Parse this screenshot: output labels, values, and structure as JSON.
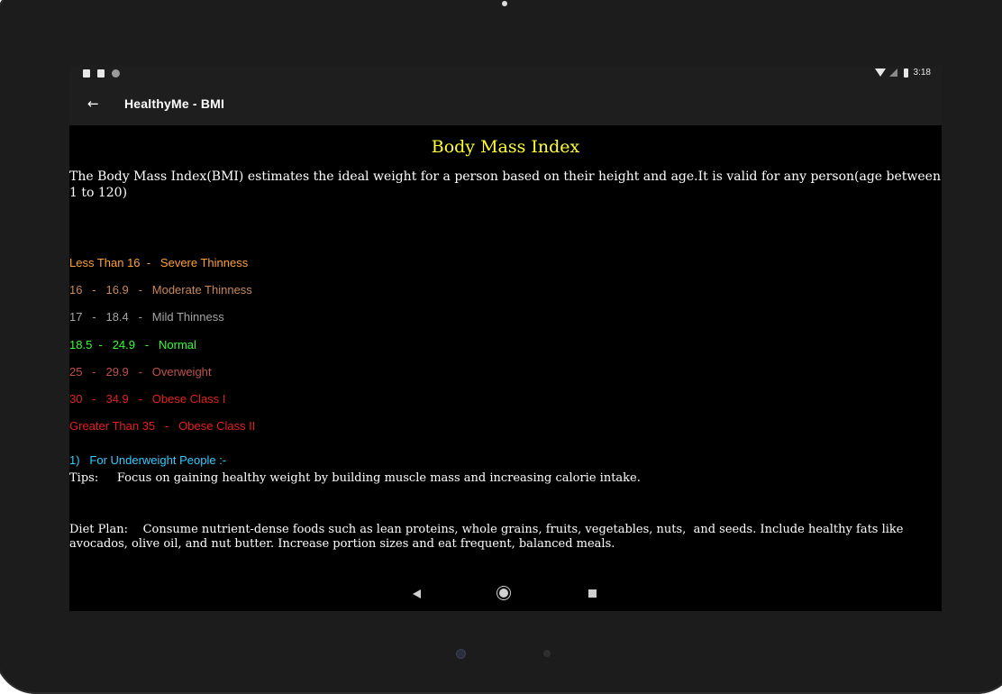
{
  "status_bar": {
    "time": "3:18"
  },
  "toolbar": {
    "back_icon": "←",
    "title": "HealthyMe - BMI"
  },
  "content": {
    "heading": "Body Mass Index",
    "intro": "The Body Mass Index(BMI) estimates the ideal weight for a person based on their height and age.It is valid for any person(age between 1 to 120)",
    "ranges": [
      {
        "text": "Less Than 16  -   Severe Thinness",
        "color": "#ffa033"
      },
      {
        "text": "16   -   16.9   -   Moderate Thinness",
        "color": "#c8885a"
      },
      {
        "text": "17   -   18.4   -   Mild Thinness",
        "color": "#a4a4a4"
      },
      {
        "text": "18.5  -   24.9   -   Normal",
        "color": "#33ff33"
      },
      {
        "text": "25   -   29.9   -   Overweight",
        "color": "#c0504d"
      },
      {
        "text": "30   -   34.9   -   Obese Class I",
        "color": "#e02020"
      },
      {
        "text": "Greater Than 35   -   Obese Class II",
        "color": "#e81e1e"
      }
    ],
    "underweight_heading": "1)   For Underweight People :-",
    "tips": "Tips:     Focus on gaining healthy weight by building muscle mass and increasing calorie intake.",
    "diet_plan": "Diet Plan:    Consume nutrient-dense foods such as lean proteins, whole grains, fruits, vegetables, nuts,  and seeds. Include healthy fats like avocados, olive oil, and nut butter. Increase portion sizes and eat frequent, balanced meals."
  }
}
